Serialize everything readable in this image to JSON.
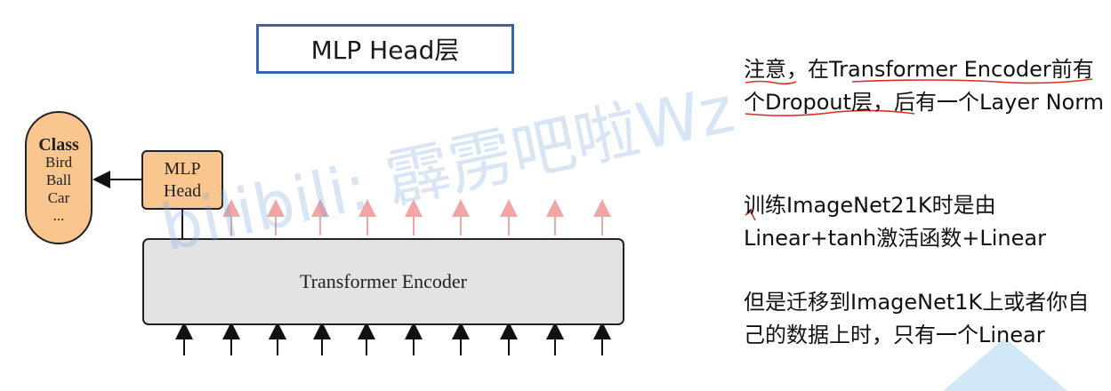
{
  "header": {
    "title": "MLP Head层"
  },
  "diagram": {
    "class_box": {
      "title": "Class",
      "items": [
        "Bird",
        "Ball",
        "Car",
        "..."
      ]
    },
    "mlp_head": {
      "line1": "MLP",
      "line2": "Head"
    },
    "encoder": {
      "label": "Transformer Encoder"
    },
    "watermark": "bilibili: 霹雳吧啦Wz"
  },
  "notes": [
    "注意，在Transformer Encoder前有个Dropout层，后有一个Layer Norm",
    "训练ImageNet21K时是由Linear+tanh激活函数+Linear",
    "但是迁移到ImageNet1K上或者你自己的数据上时，只有一个Linear"
  ],
  "colors": {
    "box_orange": "#f9c690",
    "encoder_gray": "#e3e3e3",
    "title_border": "#3b64a6",
    "output_arrows": "#f2a5a5",
    "annotation_red": "#d93025"
  }
}
